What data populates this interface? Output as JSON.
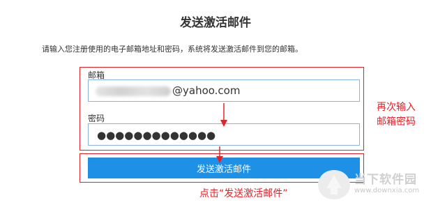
{
  "dialog": {
    "title": "发送激活邮件",
    "instruction": "请输入您注册使用的电子邮箱地址和密码，系统将发送激活邮件到您的邮箱。"
  },
  "form": {
    "email_label": "邮箱",
    "email_value": "@yahoo.com",
    "password_label": "密码",
    "password_mask": "●●●●●●●●●●●●●",
    "submit_label": "发送激活邮件"
  },
  "annotations": {
    "reenter_line1": "再次输入",
    "reenter_line2": "邮箱密码",
    "click_hint": "点击“发送激活邮件”",
    "color": "#e0242b"
  },
  "watermark": {
    "brand": "当下软件园",
    "url": "www.downxia.com"
  },
  "colors": {
    "button": "#1e90e6",
    "input_border": "#8ab4d8"
  }
}
